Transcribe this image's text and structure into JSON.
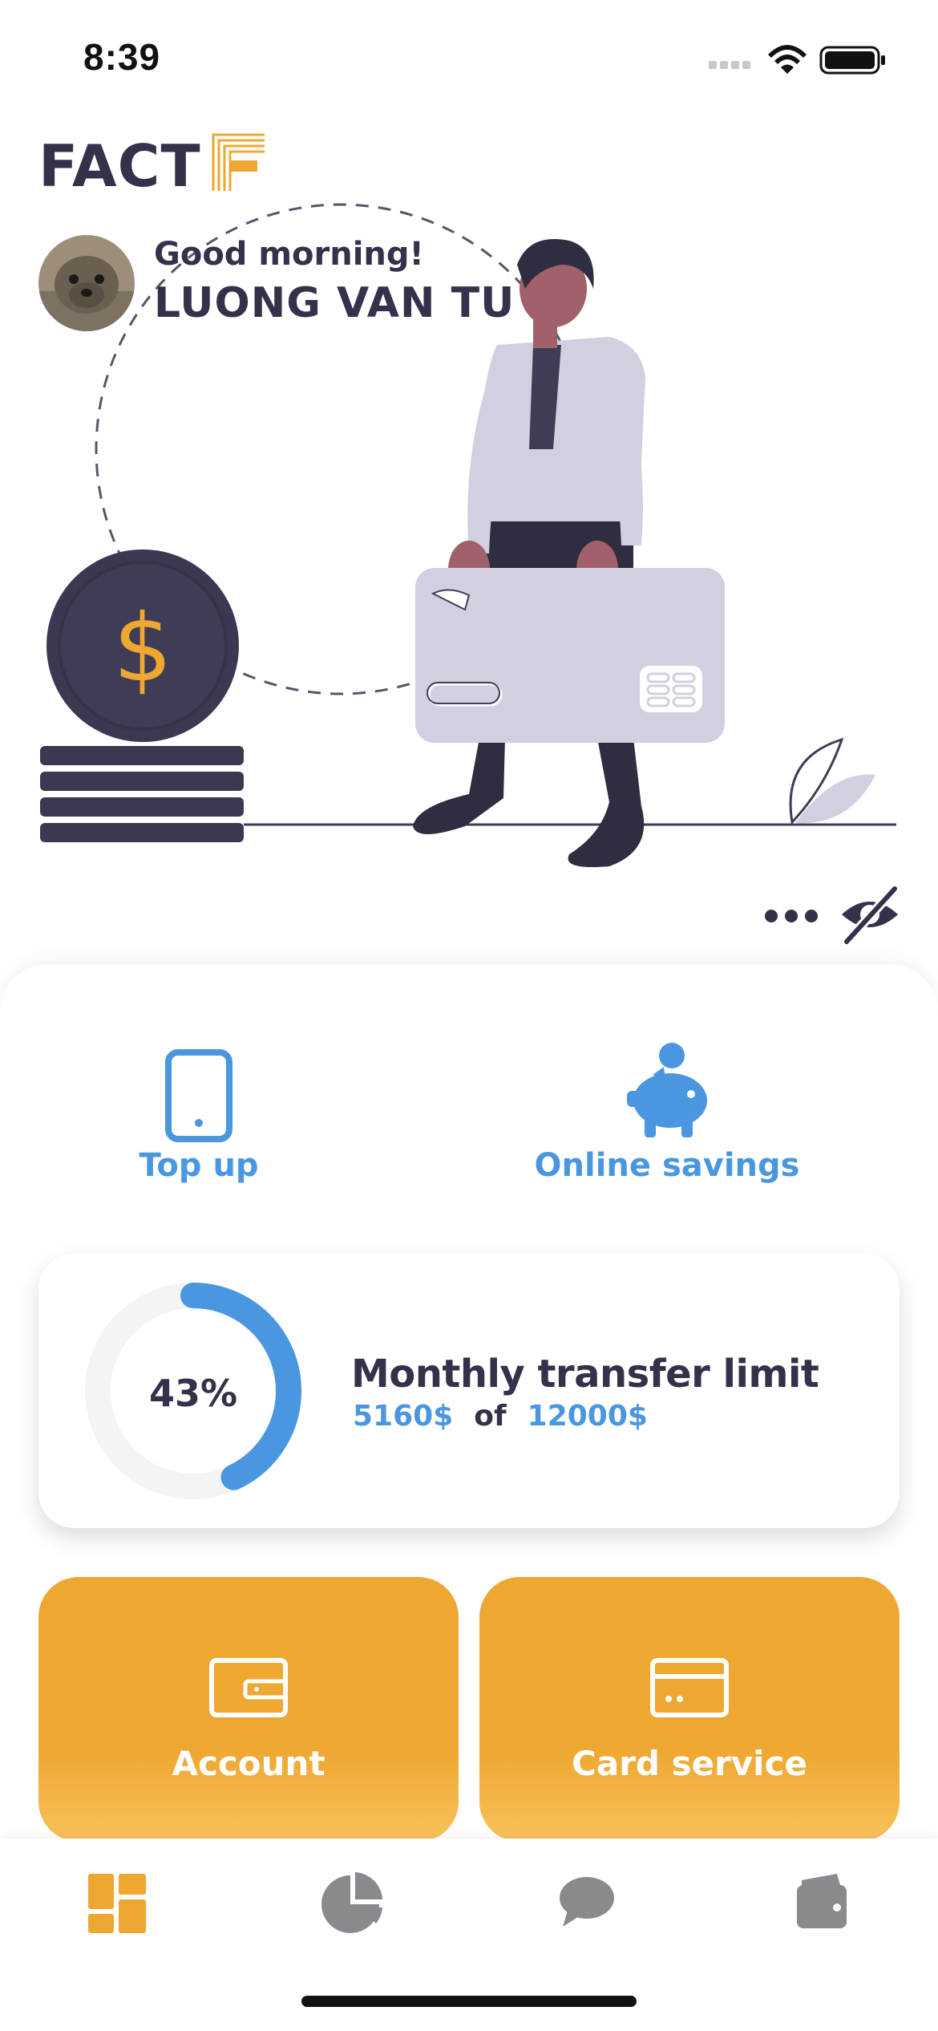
{
  "status_bar": {
    "time": "8:39"
  },
  "brand": {
    "name": "FACT",
    "accent": "#eea731",
    "primary_text": "#33324a",
    "blue": "#4a97e0"
  },
  "user": {
    "greeting": "Good morning!",
    "name": "LUONG VAN TU"
  },
  "hero": {
    "coin_symbol": "$"
  },
  "actions": {
    "more_icon": "ellipsis-icon",
    "visibility_icon": "eye-slash-icon"
  },
  "quick_actions": [
    {
      "label": "Top up",
      "icon": "phone-icon"
    },
    {
      "label": "Online savings",
      "icon": "piggy-bank-icon"
    }
  ],
  "transfer_limit": {
    "percent_label": "43%",
    "progress": 0.43,
    "title": "Monthly transfer limit",
    "used": "5160$",
    "of": "of",
    "total": "12000$"
  },
  "tiles": [
    {
      "label": "Account",
      "icon": "wallet-icon"
    },
    {
      "label": "Card service",
      "icon": "credit-card-icon"
    }
  ],
  "tabbar": [
    {
      "name": "dashboard",
      "icon": "dashboard-icon",
      "active": true
    },
    {
      "name": "statistics",
      "icon": "pie-chart-icon",
      "active": false
    },
    {
      "name": "chat",
      "icon": "chat-bubble-icon",
      "active": false
    },
    {
      "name": "wallet",
      "icon": "wallet-icon",
      "active": false
    }
  ]
}
